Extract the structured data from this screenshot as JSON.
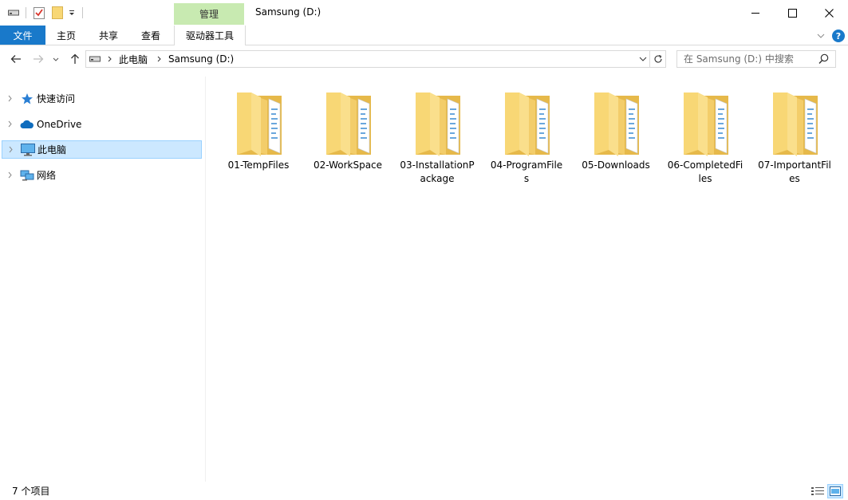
{
  "window": {
    "title": "Samsung (D:)",
    "context_tab_group": "管理"
  },
  "ribbon": {
    "tabs": [
      {
        "label": "文件"
      },
      {
        "label": "主页"
      },
      {
        "label": "共享"
      },
      {
        "label": "查看"
      },
      {
        "label": "驱动器工具"
      }
    ],
    "help_label": "?"
  },
  "address_bar": {
    "breadcrumbs": [
      "此电脑",
      "Samsung (D:)"
    ]
  },
  "search": {
    "placeholder": "在 Samsung (D:) 中搜索"
  },
  "sidebar": {
    "items": [
      {
        "label": "快速访问",
        "icon": "star-icon",
        "selected": false
      },
      {
        "label": "OneDrive",
        "icon": "cloud-icon",
        "selected": false
      },
      {
        "label": "此电脑",
        "icon": "computer-icon",
        "selected": true
      },
      {
        "label": "网络",
        "icon": "network-icon",
        "selected": false
      }
    ]
  },
  "content": {
    "folders": [
      {
        "name": "01-TempFiles"
      },
      {
        "name": "02-WorkSpace"
      },
      {
        "name": "03-InstallationPackage"
      },
      {
        "name": "04-ProgramFiles"
      },
      {
        "name": "05-Downloads"
      },
      {
        "name": "06-CompletedFiles"
      },
      {
        "name": "07-ImportantFiles"
      }
    ]
  },
  "status": {
    "item_count": "7 个项目"
  },
  "colors": {
    "accent": "#1979ca",
    "context_tab": "#c8eab1",
    "selection": "#cce8ff",
    "folder": "#f8d775"
  }
}
